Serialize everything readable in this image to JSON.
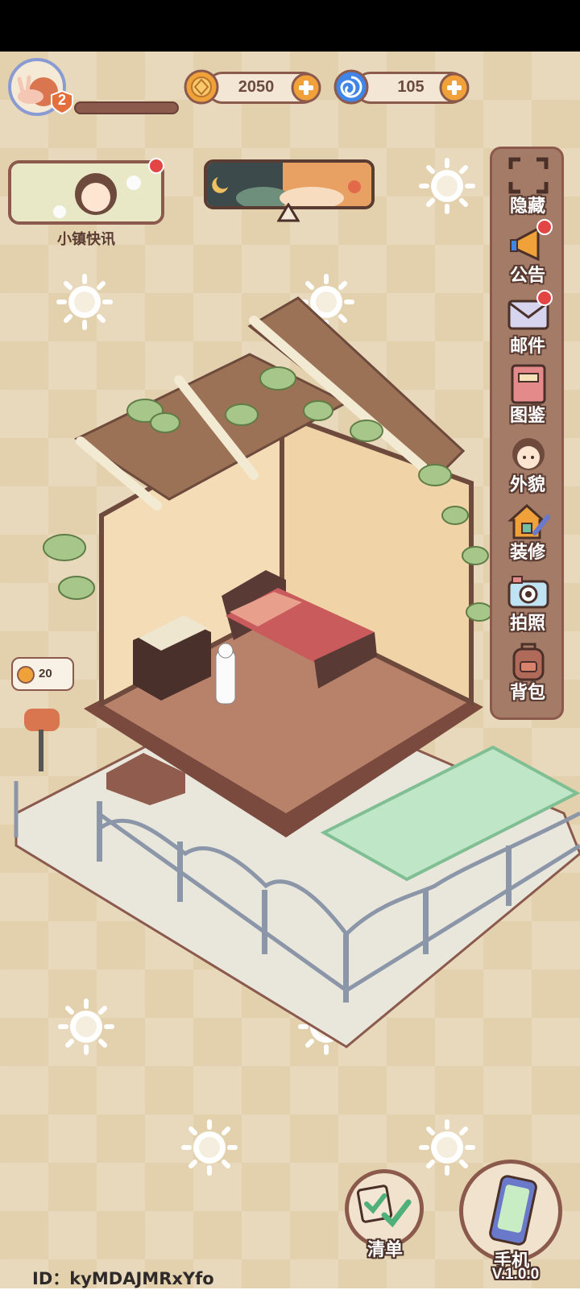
{
  "player": {
    "level": "2",
    "xp_progress": 0.0
  },
  "currency": {
    "coins": "2050",
    "gems": "105"
  },
  "news": {
    "label": "小镇快讯"
  },
  "sidebar": {
    "items": [
      {
        "label": "隐藏",
        "icon": "fullscreen-icon",
        "badge": false
      },
      {
        "label": "公告",
        "icon": "megaphone-icon",
        "badge": true
      },
      {
        "label": "邮件",
        "icon": "envelope-icon",
        "badge": true
      },
      {
        "label": "图鉴",
        "icon": "book-icon",
        "badge": false
      },
      {
        "label": "外貌",
        "icon": "character-face-icon",
        "badge": false
      },
      {
        "label": "装修",
        "icon": "house-wrench-icon",
        "badge": false
      },
      {
        "label": "拍照",
        "icon": "camera-icon",
        "badge": false
      },
      {
        "label": "背包",
        "icon": "backpack-icon",
        "badge": false
      }
    ]
  },
  "mailbox": {
    "count": "20"
  },
  "bottom": {
    "checklist_label": "清单",
    "phone_label": "手机",
    "version": "V.1.0.0",
    "user_id": "ID：kyMDAJMRxYfo"
  },
  "colors": {
    "background": "#e3d1ad",
    "accent_brown": "#8b5a4d",
    "badge_red": "#e34545",
    "plus_orange": "#f0a13a",
    "gem_blue": "#3f86e8"
  }
}
